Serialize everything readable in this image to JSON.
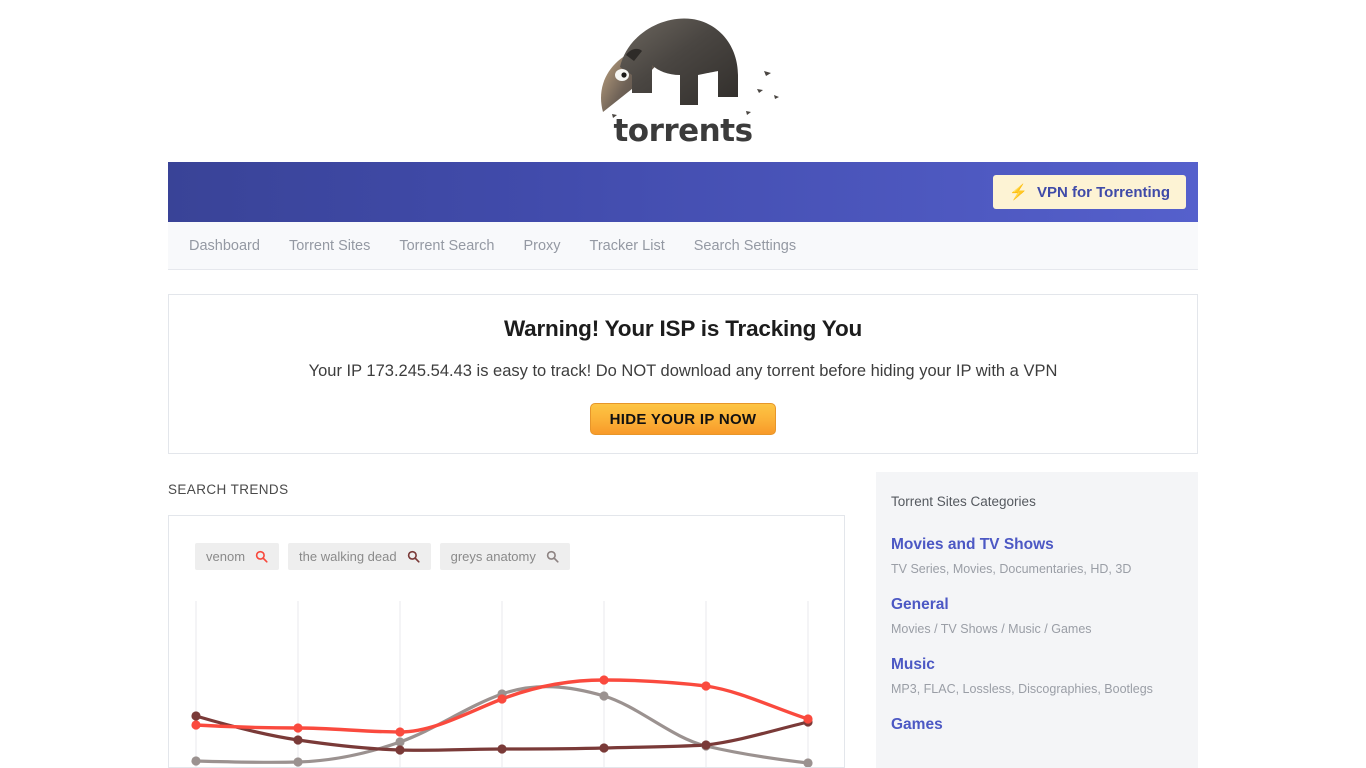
{
  "brand": {
    "word": "torrents",
    "logo_icon": "anteater-logo-icon"
  },
  "vpn_bar": {
    "button_label": "VPN for Torrenting",
    "bolt_icon": "lightning-bolt-icon",
    "bg_start": "#394397",
    "bg_end": "#5560cc",
    "button_bg": "#fdf3d4",
    "button_text_color": "#3f4aa8"
  },
  "nav": {
    "items": [
      {
        "label": "Dashboard"
      },
      {
        "label": "Torrent Sites"
      },
      {
        "label": "Torrent Search"
      },
      {
        "label": "Proxy"
      },
      {
        "label": "Tracker List"
      },
      {
        "label": "Search Settings"
      }
    ]
  },
  "warning": {
    "title": "Warning! Your ISP is Tracking You",
    "ip": "173.245.54.43",
    "subtitle": "Your IP 173.245.54.43 is easy to track! Do NOT download any torrent before hiding your IP with a VPN",
    "button_label": "HIDE YOUR IP NOW",
    "button_color": "#fbb037"
  },
  "trends": {
    "section_label": "SEARCH TRENDS",
    "chips": [
      {
        "text": "venom",
        "icon": "search-icon",
        "color": "#f8483c"
      },
      {
        "text": "the walking dead",
        "icon": "search-icon",
        "color": "#7a3a38"
      },
      {
        "text": "greys anatomy",
        "icon": "search-icon",
        "color": "#8d8382"
      }
    ]
  },
  "chart_data": {
    "type": "line",
    "title": "SEARCH TRENDS",
    "xlabel": "",
    "ylabel": "",
    "grid": true,
    "gridlines_x": [
      195,
      297,
      399,
      501,
      603,
      705,
      807
    ],
    "legend_position": "top-left-as-chips",
    "x": [
      1,
      2,
      3,
      4,
      5,
      6,
      7
    ],
    "ylim": [
      0,
      100
    ],
    "series": [
      {
        "name": "venom",
        "color": "#f8483c",
        "values": [
          52,
          50,
          48,
          58,
          72,
          70,
          54
        ]
      },
      {
        "name": "the walking dead",
        "color": "#7a3a38",
        "values": [
          56,
          44,
          36,
          37,
          38,
          38,
          51
        ]
      },
      {
        "name": "greys anatomy",
        "color": "#8d8382",
        "values": [
          30,
          30,
          36,
          58,
          62,
          41,
          27
        ]
      }
    ]
  },
  "sidebar": {
    "title": "Torrent Sites Categories",
    "categories": [
      {
        "name": "Movies and TV Shows",
        "desc": "TV Series, Movies, Documentaries, HD, 3D"
      },
      {
        "name": "General",
        "desc": "Movies / TV Shows / Music / Games"
      },
      {
        "name": "Music",
        "desc": "MP3, FLAC, Lossless, Discographies, Bootlegs"
      },
      {
        "name": "Games",
        "desc": ""
      }
    ],
    "accent_color": "#4c58c4"
  }
}
